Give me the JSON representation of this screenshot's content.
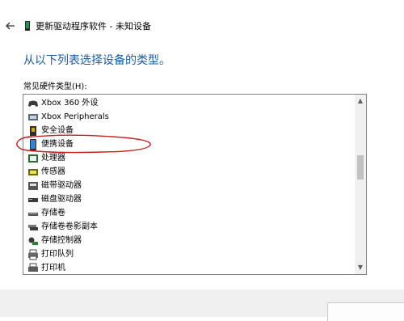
{
  "window": {
    "title": "更新驱动程序软件 - 未知设备",
    "back_icon": "arrow-left-icon",
    "title_icon": "device-icon"
  },
  "main": {
    "heading": "从以下列表选择设备的类型。",
    "list_label": "常见硬件类型(H):"
  },
  "list": {
    "items": [
      {
        "label": "Xbox 360 外设",
        "icon": "gamepad-icon"
      },
      {
        "label": "Xbox Peripherals",
        "icon": "xbox-peripherals-icon"
      },
      {
        "label": "安全设备",
        "icon": "security-device-icon"
      },
      {
        "label": "便携设备",
        "icon": "portable-device-icon"
      },
      {
        "label": "处理器",
        "icon": "processor-icon"
      },
      {
        "label": "传感器",
        "icon": "sensor-icon"
      },
      {
        "label": "磁带驱动器",
        "icon": "tape-drive-icon"
      },
      {
        "label": "磁盘驱动器",
        "icon": "disk-drive-icon"
      },
      {
        "label": "存储卷",
        "icon": "storage-volume-icon"
      },
      {
        "label": "存储卷卷影副本",
        "icon": "volume-shadow-copy-icon"
      },
      {
        "label": "存储控制器",
        "icon": "storage-controller-icon"
      },
      {
        "label": "打印队列",
        "icon": "print-queue-icon"
      },
      {
        "label": "打印机",
        "icon": "printer-icon"
      }
    ],
    "scroll_up_glyph": "▲",
    "scroll_down_glyph": "▼",
    "annotation_color": "#c8201e"
  },
  "colors": {
    "heading": "#1c5aa8",
    "list_border": "#828282",
    "footer": "#f0f0f0"
  }
}
